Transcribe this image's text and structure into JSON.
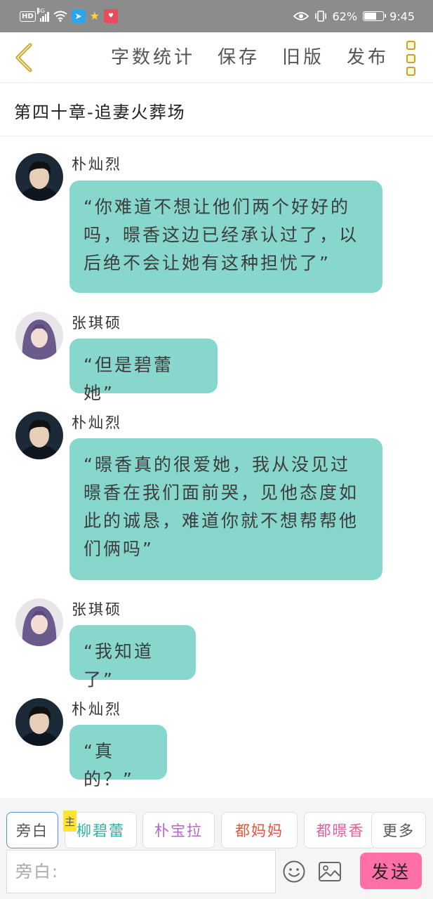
{
  "status_bar": {
    "hd": "HD",
    "network": "4G",
    "battery": "62%",
    "battery_level": 0.62,
    "time": "9:45"
  },
  "toolbar": {
    "back_icon": "chevron-left-icon",
    "word_count": "字数统计",
    "save": "保存",
    "old_version": "旧版",
    "publish": "发布",
    "more_icon": "vertical-dots-icon",
    "accent_color": "#c9a227"
  },
  "chapter": {
    "title": "第四十章-追妻火葬场"
  },
  "messages": [
    {
      "sender": "朴灿烈",
      "avatar": "male-avatar",
      "text": "“你难道不想让他们两个好好的吗，暻香这边已经承认过了，以后绝不会让她有这种担忧了”"
    },
    {
      "sender": "张琪硕",
      "avatar": "female-avatar",
      "text": "“但是碧蕾她”"
    },
    {
      "sender": "朴灿烈",
      "avatar": "male-avatar",
      "text": "“暻香真的很爱她，我从没见过暻香在我们面前哭，见他态度如此的诚恳，难道你就不想帮帮他们俩吗”"
    },
    {
      "sender": "张琪硕",
      "avatar": "female-avatar",
      "text": "“我知道了”"
    },
    {
      "sender": "朴灿烈",
      "avatar": "male-avatar",
      "text": "“真的？”"
    }
  ],
  "bubble_color": "#87d7cc",
  "roles": [
    {
      "label": "旁白",
      "color": "#555555",
      "active": true
    },
    {
      "label": "柳碧蕾",
      "color": "#2bb3a8",
      "main_tag": "主"
    },
    {
      "label": "朴宝拉",
      "color": "#b865d0"
    },
    {
      "label": "都妈妈",
      "color": "#e0553d"
    },
    {
      "label": "都暻香",
      "color": "#e05e9a"
    },
    {
      "label": "更多",
      "color": "#555555"
    }
  ],
  "input": {
    "placeholder": "旁白:",
    "emoji_icon": "smiley-icon",
    "image_icon": "image-icon",
    "send_label": "发送",
    "send_color": "#ff6fa8"
  }
}
